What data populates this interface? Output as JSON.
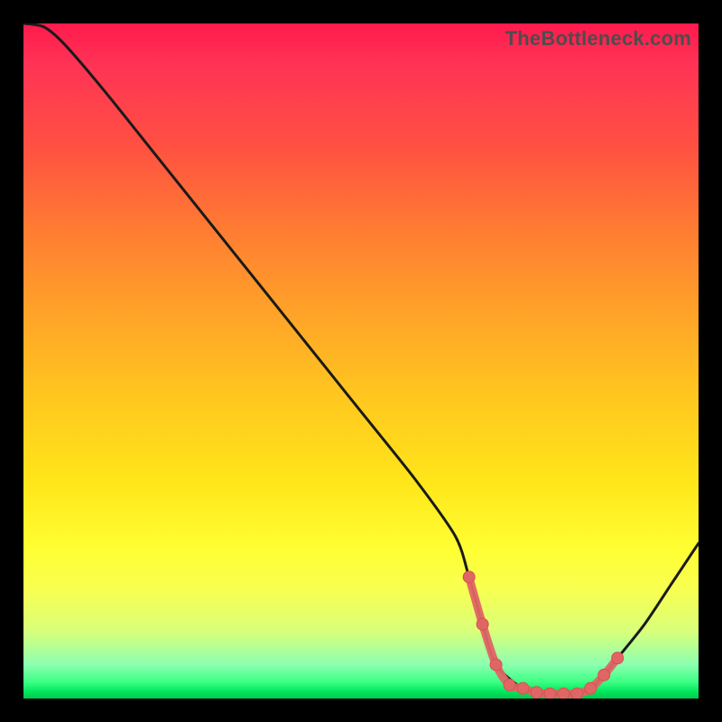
{
  "watermark": "TheBottleneck.com",
  "colors": {
    "curve_stroke": "#1a1a1a",
    "marker_fill": "#e06666",
    "marker_stroke": "#d94f4f"
  },
  "chart_data": {
    "type": "line",
    "title": "",
    "xlabel": "",
    "ylabel": "",
    "xlim": [
      0,
      100
    ],
    "ylim": [
      0,
      100
    ],
    "series": [
      {
        "name": "bottleneck-curve",
        "x": [
          0,
          3,
          6,
          12,
          20,
          30,
          40,
          50,
          58,
          64,
          66,
          68,
          70,
          74,
          78,
          82,
          84,
          86,
          88,
          92,
          96,
          100
        ],
        "values": [
          100,
          99.5,
          97,
          90,
          80,
          67.5,
          55,
          42.5,
          32.5,
          24,
          18,
          11,
          5,
          1.5,
          0.7,
          0.7,
          1.5,
          3.5,
          6,
          11,
          17,
          23
        ]
      }
    ],
    "markers": {
      "name": "highlight-points",
      "x": [
        66,
        68,
        70,
        72,
        74,
        76,
        78,
        80,
        82,
        84,
        86,
        88
      ],
      "values": [
        18,
        11,
        5,
        2,
        1.5,
        0.9,
        0.7,
        0.7,
        0.7,
        1.5,
        3.5,
        6
      ]
    }
  }
}
